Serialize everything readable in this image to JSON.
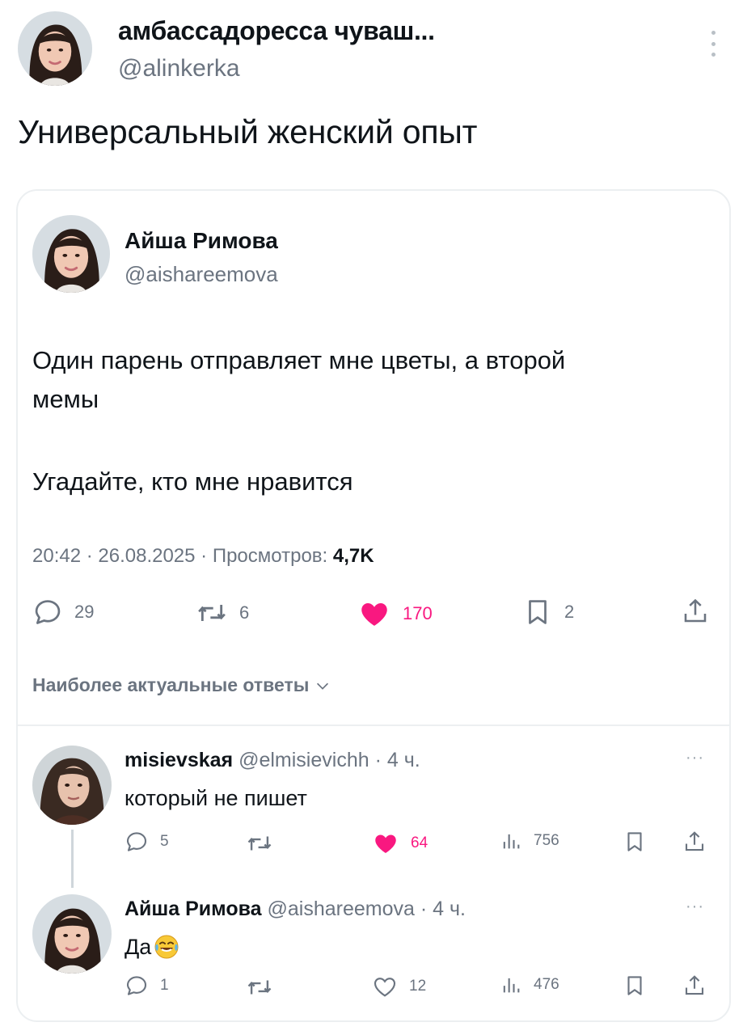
{
  "top_post": {
    "author_name": "амбассадоресса чуваш...",
    "handle": "@alinkerka",
    "text": "Универсальный женский опыт"
  },
  "quoted_post": {
    "author_name": "Айша Римова",
    "handle": "@aishareemova",
    "text_line1": "Один парень отправляет мне цветы, а второй",
    "text_line2": "мемы",
    "text_line3": "Угадайте, кто мне нравится",
    "meta": "20:42 · 26.08.2025 · Просмотров: ",
    "views": "4,7K",
    "replies": "29",
    "reposts": "6",
    "likes": "170",
    "bookmarks": "2",
    "like_color": "#f91880"
  },
  "replies_sort": {
    "label": "Наиболее актуальные ответы"
  },
  "replies": [
    {
      "author_name": "misievskaя",
      "handle_time": "@elmisievichh · 4 ч.",
      "text": "который не пишет",
      "replies": "5",
      "reposts": "",
      "likes": "64",
      "views": "756",
      "liked": true
    },
    {
      "author_name": "Айша Римова",
      "handle_time": "@aishareemova · 4 ч.",
      "text": "Да",
      "emoji": "laughing-tears-emoji",
      "replies": "1",
      "reposts": "",
      "likes": "12",
      "views": "476",
      "liked": false
    }
  ],
  "more_glyph": "···"
}
